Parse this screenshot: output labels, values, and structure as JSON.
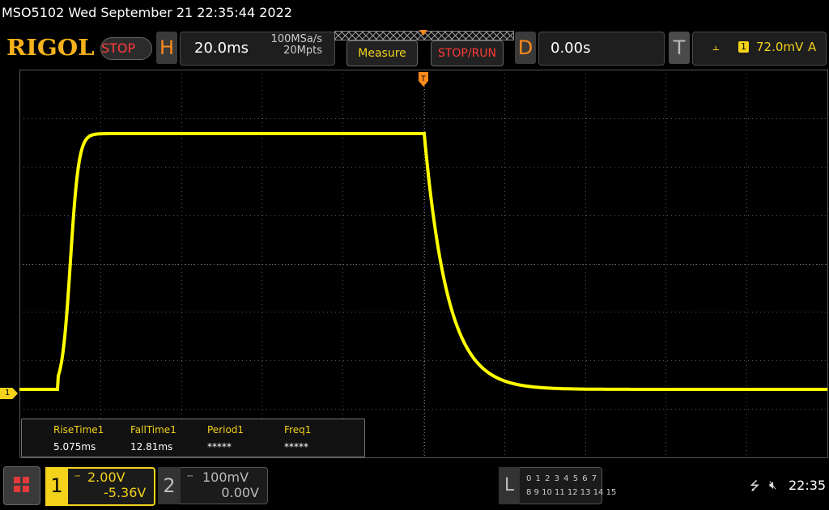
{
  "titlebar": {
    "text": "MSO5102  Wed September 21 22:35:44 2022"
  },
  "toolbar": {
    "brand": "RIGOL",
    "run_state": "STOP",
    "horizontal": {
      "letter": "H",
      "time_per_div": "20.0ms",
      "sample_rate": "100MSa/s",
      "memory_depth": "20Mpts"
    },
    "measure_label": "Measure",
    "stoprun_label": "STOP/RUN",
    "delay": {
      "letter": "D",
      "value": "0.00s"
    },
    "trigger": {
      "letter": "T",
      "source": "1",
      "level": "72.0mV",
      "mode": "A",
      "edge_icon": "rising-edge-icon"
    }
  },
  "waveform": {
    "channel_marker": "1",
    "trace_color": "#ffff00",
    "grid_divisions": {
      "horizontal": 10,
      "vertical": 8
    },
    "rise_time_ms": 5.075,
    "fall_time_ms": 12.81
  },
  "measurements": [
    {
      "label": "RiseTime1",
      "value": "5.075ms"
    },
    {
      "label": "FallTime1",
      "value": "12.81ms"
    },
    {
      "label": "Period1",
      "value": "*****"
    },
    {
      "label": "Freq1",
      "value": "*****"
    }
  ],
  "channels": {
    "ch1": {
      "number": "1",
      "coupling": "DC",
      "scale": "2.00V",
      "offset": "-5.36V",
      "color": "#f2d21b"
    },
    "ch2": {
      "number": "2",
      "coupling": "DC",
      "scale": "100mV",
      "offset": "0.00V",
      "color": "#bbbbbb"
    }
  },
  "logic": {
    "letter": "L",
    "row1": "0 1 2 3   4 5 6 7",
    "row2": "8 9 10 11 12 13 14 15"
  },
  "status": {
    "clock": "22:35",
    "usb_icon": "usb-icon",
    "speaker_icon": "speaker-muted-icon"
  }
}
